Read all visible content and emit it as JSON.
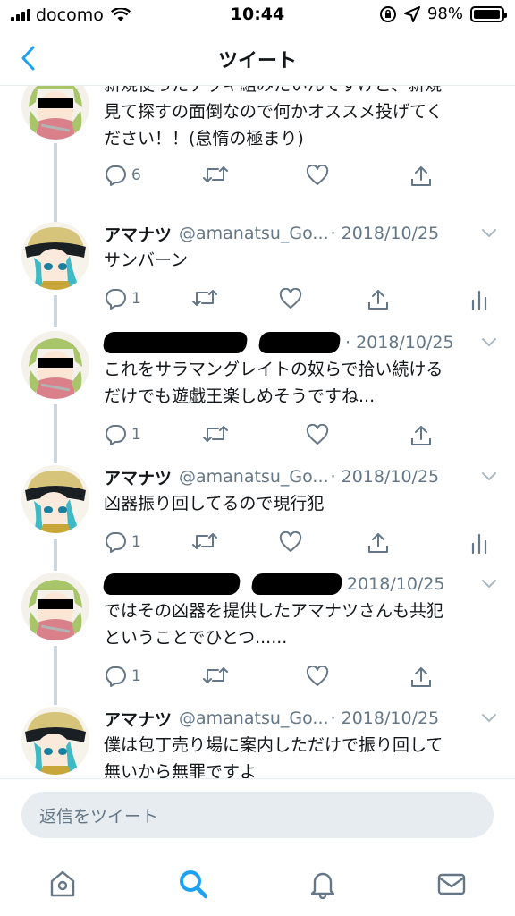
{
  "status_bar": {
    "carrier": "docomo",
    "time": "10:44",
    "battery": "98%",
    "battery_level": 0.98,
    "icons": [
      "signal-icon",
      "wifi-icon",
      "rotation-lock-icon",
      "location-icon",
      "battery-icon"
    ]
  },
  "nav": {
    "title": "ツイート",
    "back_icon": "chevron-left-icon"
  },
  "colors": {
    "accent": "#1da1f2",
    "text": "#14171a",
    "muted": "#657786",
    "thread_line": "#ccd6dd",
    "input_bg": "#e6ecf0"
  },
  "tweets": [
    {
      "name": "",
      "handle": "",
      "date": "",
      "redacted": true,
      "lines": [
        "新規使ったデッキ組みたいんですけど、新規",
        "見て探すの面倒なので何かオススメ投げてく",
        "ださい！！(怠惰の極まり)"
      ],
      "reply_count": "6",
      "has_analytics": false
    },
    {
      "name": "アマナツ",
      "handle": "@amanatsu_Go...",
      "date": "· 2018/10/25",
      "redacted": false,
      "lines": [
        "サンバーン"
      ],
      "reply_count": "1",
      "has_analytics": true
    },
    {
      "name": "",
      "handle": "",
      "date": "· 2018/10/25",
      "redacted": true,
      "lines": [
        "これをサラマングレイトの奴らで拾い続ける",
        "だけでも遊戯王楽しめそうですね..."
      ],
      "reply_count": "1",
      "has_analytics": false
    },
    {
      "name": "アマナツ",
      "handle": "@amanatsu_Go...",
      "date": "· 2018/10/25",
      "redacted": false,
      "lines": [
        "凶器振り回してるので現行犯"
      ],
      "reply_count": "1",
      "has_analytics": true
    },
    {
      "name": "",
      "handle": "",
      "date": "2018/10/25",
      "redacted": true,
      "lines": [
        "ではその凶器を提供したアマナツさんも共犯",
        "ということでひとつ......"
      ],
      "reply_count": "1",
      "has_analytics": false
    },
    {
      "name": "アマナツ",
      "handle": "@amanatsu_Go...",
      "date": "· 2018/10/25",
      "redacted": false,
      "lines": [
        "僕は包丁売り場に案内しただけで振り回して",
        "無いから無罪ですよ"
      ],
      "reply_count": "",
      "has_analytics": false
    }
  ],
  "reply": {
    "placeholder": "返信をツイート"
  },
  "tabs": [
    {
      "name": "home",
      "icon": "home-icon",
      "active": false
    },
    {
      "name": "search",
      "icon": "search-icon",
      "active": true
    },
    {
      "name": "notifications",
      "icon": "bell-icon",
      "active": false
    },
    {
      "name": "messages",
      "icon": "mail-icon",
      "active": false
    }
  ]
}
